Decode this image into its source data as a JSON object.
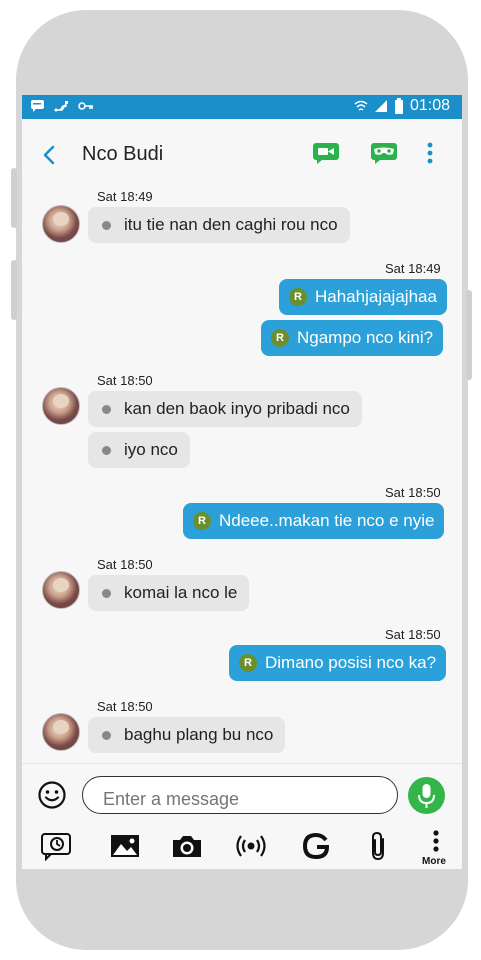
{
  "status_bar": {
    "time": "01:08"
  },
  "header": {
    "contact_name": "Nco Budi"
  },
  "messages": [
    {
      "dir": "in",
      "time": "Sat 18:49",
      "text": "itu tie nan den caghi rou nco"
    },
    {
      "dir": "out",
      "time": "Sat 18:49",
      "text": "Hahahjajajajhaa"
    },
    {
      "dir": "out",
      "time": "",
      "text": "Ngampo nco kini?"
    },
    {
      "dir": "in",
      "time": "Sat 18:50",
      "text": "kan den baok inyo pribadi nco"
    },
    {
      "dir": "in",
      "time": "",
      "text": "iyo nco"
    },
    {
      "dir": "out",
      "time": "Sat 18:50",
      "text": "Ndeee..makan tie nco e nyie"
    },
    {
      "dir": "in",
      "time": "Sat 18:50",
      "text": "komai la nco le"
    },
    {
      "dir": "out",
      "time": "Sat 18:50",
      "text": "Dimano posisi nco ka?"
    },
    {
      "dir": "in",
      "time": "Sat 18:50",
      "text": "baghu plang bu nco"
    }
  ],
  "composer": {
    "placeholder": "Enter a message"
  },
  "toolbar": {
    "more_label": "More"
  },
  "badge_letter": "R",
  "colors": {
    "status_bar": "#1a8fc9",
    "outgoing_bubble": "#2ca0d9",
    "incoming_bubble": "#e6e6e6",
    "mic": "#34b54a",
    "header_icons": "#2bb24c"
  },
  "icons": [
    "back-arrow-icon",
    "video-call-icon",
    "mask-icon",
    "overflow-menu-icon",
    "smiley-icon",
    "mic-icon",
    "sticker-icon",
    "image-icon",
    "camera-icon",
    "broadcast-icon",
    "google-icon",
    "paperclip-icon",
    "more-icon"
  ]
}
